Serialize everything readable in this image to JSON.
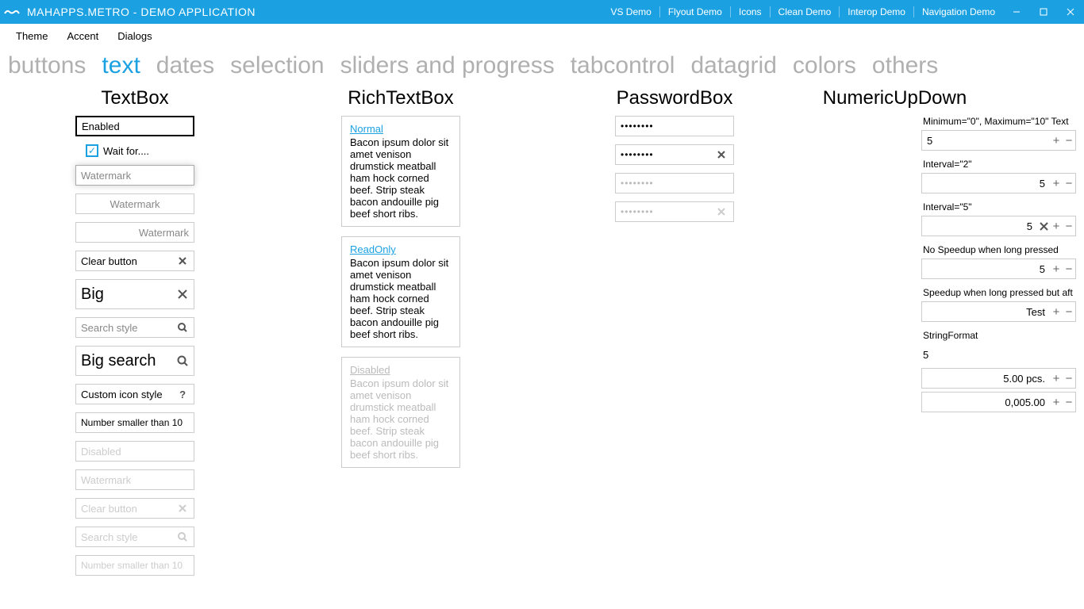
{
  "titlebar": {
    "app_title": "MAHAPPS.METRO - DEMO APPLICATION",
    "links": [
      "VS Demo",
      "Flyout Demo",
      "Icons",
      "Clean Demo",
      "Interop Demo",
      "Navigation Demo"
    ]
  },
  "menu": {
    "items": [
      "Theme",
      "Accent",
      "Dialogs"
    ]
  },
  "tabs": {
    "items": [
      "buttons",
      "text",
      "dates",
      "selection",
      "sliders and progress",
      "tabcontrol",
      "datagrid",
      "colors",
      "others"
    ],
    "active": 1
  },
  "textbox": {
    "header": "TextBox",
    "enabled_value": "Enabled",
    "waitfor_label": "Wait for....",
    "watermark_ph": "Watermark",
    "watermark_center_ph": "Watermark",
    "watermark_right_ph": "Watermark",
    "clear_value": "Clear button",
    "big_value": "Big",
    "search_ph": "Search style",
    "bigsearch_value": "Big search",
    "custom_value": "Custom icon style",
    "number_value": "Number smaller than 10",
    "disabled_ph": "Disabled",
    "disabled_watermark_ph": "Watermark",
    "disabled_clear_ph": "Clear button",
    "disabled_search_ph": "Search style",
    "disabled_number_ph": "Number smaller than 10"
  },
  "richtextbox": {
    "header": "RichTextBox",
    "normal_link": "Normal",
    "readonly_link": "ReadOnly",
    "disabled_link": "Disabled",
    "body": "Bacon ipsum dolor sit amet venison drumstick meatball ham hock corned beef. Strip steak bacon andouille pig beef short ribs."
  },
  "passwordbox": {
    "header": "PasswordBox",
    "pw1": "••••••••",
    "pw2": "••••••••",
    "pw3": "••••••••",
    "pw4": "••••••••"
  },
  "numeric": {
    "header": "NumericUpDown",
    "label1": "Minimum=\"0\", Maximum=\"10\" Text",
    "val1": "5",
    "label2": "Interval=\"2\"",
    "val2": "5",
    "label3": "Interval=\"5\"",
    "val3": "5",
    "label4": "No Speedup when long pressed",
    "val4": "5",
    "label5": "Speedup when long pressed but aft",
    "val5": "Test",
    "label6": "StringFormat",
    "plain": "5",
    "val6": "5.00 pcs.",
    "val7": "0,005.00"
  }
}
